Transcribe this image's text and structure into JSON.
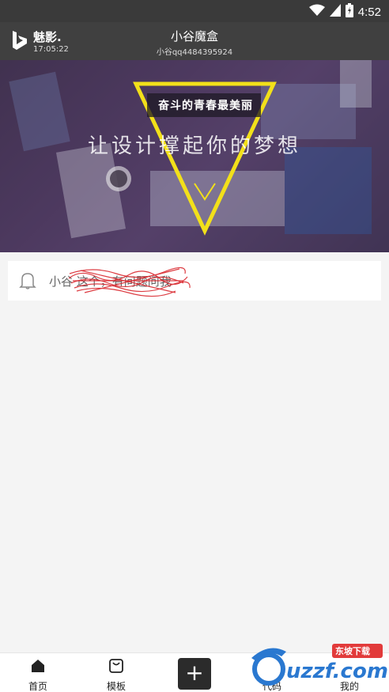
{
  "status_bar": {
    "time": "4:52"
  },
  "header": {
    "brand_name": "魅影.",
    "brand_time": "17:05:22",
    "title": "小谷魔盒",
    "subtitle": "小谷qq4484395924"
  },
  "banner": {
    "tag": "奋斗的青春最美丽",
    "title": "让设计撑起你的梦想"
  },
  "notice": {
    "text": "小谷 这个，有问题问我"
  },
  "tabs": [
    {
      "label": "首页",
      "icon": "home-icon"
    },
    {
      "label": "模板",
      "icon": "bag-icon"
    },
    {
      "label": "代码",
      "icon": "code-icon"
    },
    {
      "label": "我的",
      "icon": "user-icon"
    }
  ],
  "add_button": {
    "label": "+"
  },
  "watermark": {
    "brand": "uzzf.com",
    "tag": "东坡下载"
  }
}
